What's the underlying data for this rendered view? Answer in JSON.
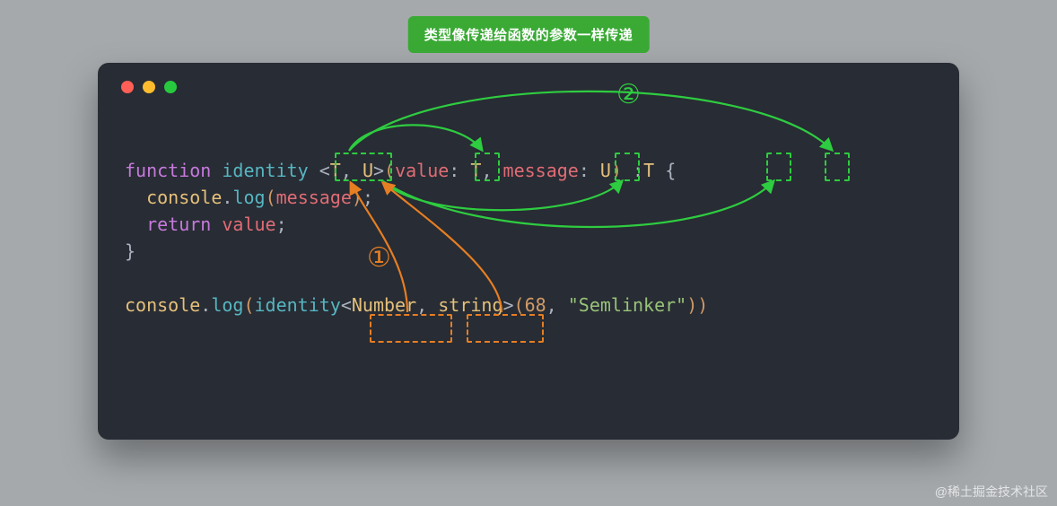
{
  "title_badge": "类型像传递给函数的参数一样传递",
  "watermark": "@稀土掘金技术社区",
  "arrow_colors": {
    "type_to_params": "#2ecc40",
    "args_to_types": "#e67e22"
  },
  "labels": {
    "step1": "①",
    "step2": "②"
  },
  "code": {
    "function_keyword": "function",
    "function_name": "identity",
    "type_params": [
      "T",
      "U"
    ],
    "params": [
      {
        "name": "value",
        "type": "T"
      },
      {
        "name": "message",
        "type": "U"
      }
    ],
    "return_type": "T",
    "body_console": "console",
    "body_log": "log",
    "body_log_arg": "message",
    "return_keyword": "return",
    "return_value": "value",
    "call_console": "console",
    "call_log": "log",
    "call_fn": "identity",
    "call_type_args": [
      "Number",
      "string"
    ],
    "call_args_num": "68",
    "call_args_str": "\"Semlinker\""
  }
}
